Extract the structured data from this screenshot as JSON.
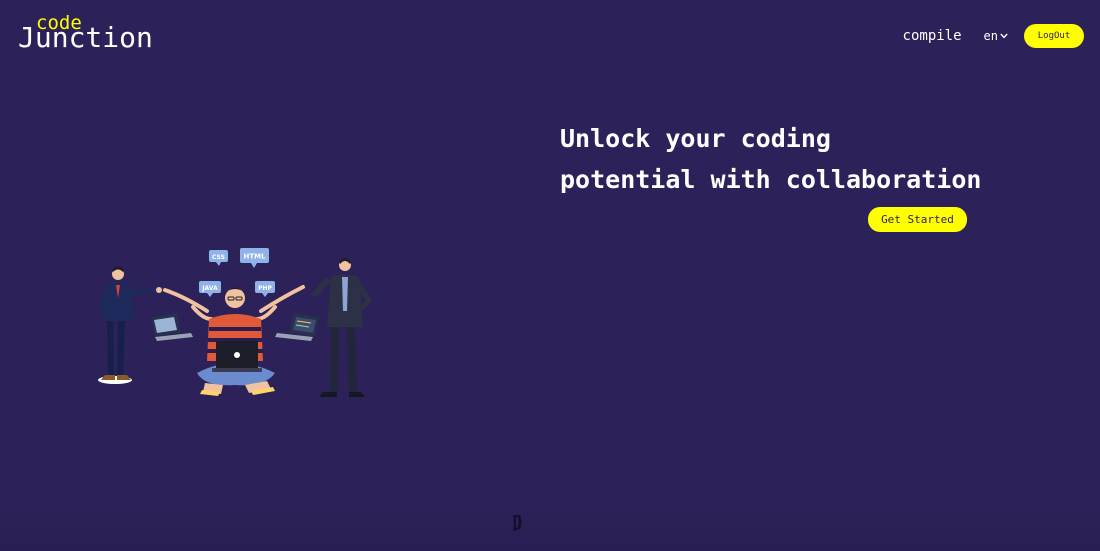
{
  "header": {
    "logo_top": "code",
    "logo_main": "Junction",
    "nav": {
      "compile": "compile",
      "language": "en",
      "logout": "LogOut"
    }
  },
  "hero": {
    "title_line1": "Unlock your coding",
    "title_line2": "potential with collaboration",
    "cta": "Get Started"
  },
  "illustration": {
    "bubbles": [
      "CSS",
      "HTML",
      "JAVA",
      "PHP"
    ]
  },
  "colors": {
    "background": "#2d2159",
    "accent": "#ffff00",
    "text": "#ffffff"
  },
  "icons": {
    "language_dropdown": "chevron-down-icon"
  }
}
